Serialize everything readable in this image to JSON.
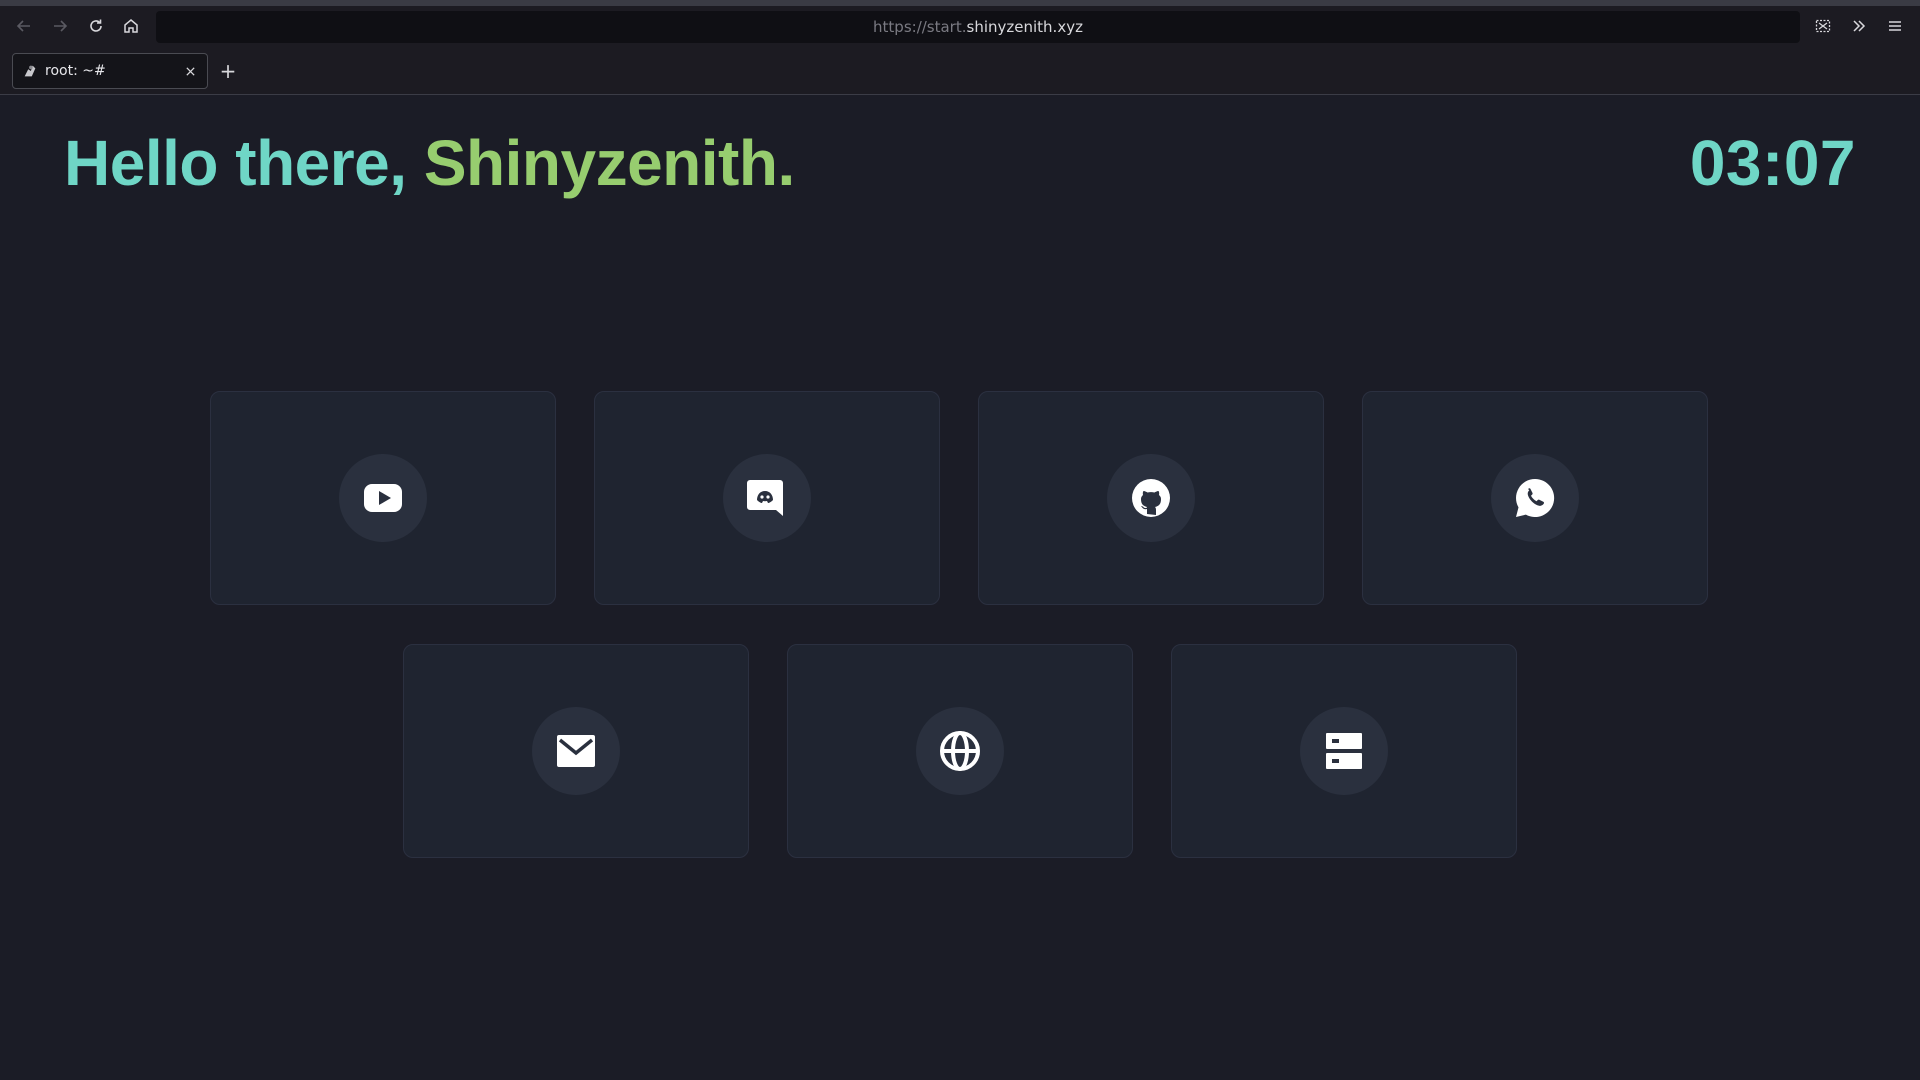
{
  "browser": {
    "url_prefix": "https://start.",
    "url_host": "shinyzenith.xyz",
    "tab_title": "root: ~#",
    "new_tab_label": "+"
  },
  "page": {
    "greeting_prefix": "Hello there, ",
    "greeting_name": "Shinyzenith.",
    "clock": "03:07"
  },
  "shortcuts": [
    {
      "icon": "youtube-icon"
    },
    {
      "icon": "discord-icon"
    },
    {
      "icon": "github-icon"
    },
    {
      "icon": "whatsapp-icon"
    },
    {
      "icon": "mail-icon"
    },
    {
      "icon": "globe-icon"
    },
    {
      "icon": "server-icon"
    }
  ],
  "colors": {
    "background": "#1b1c26",
    "card": "#1f2430",
    "accent_teal": "#6fd6c6",
    "accent_green": "#97cd6f"
  }
}
